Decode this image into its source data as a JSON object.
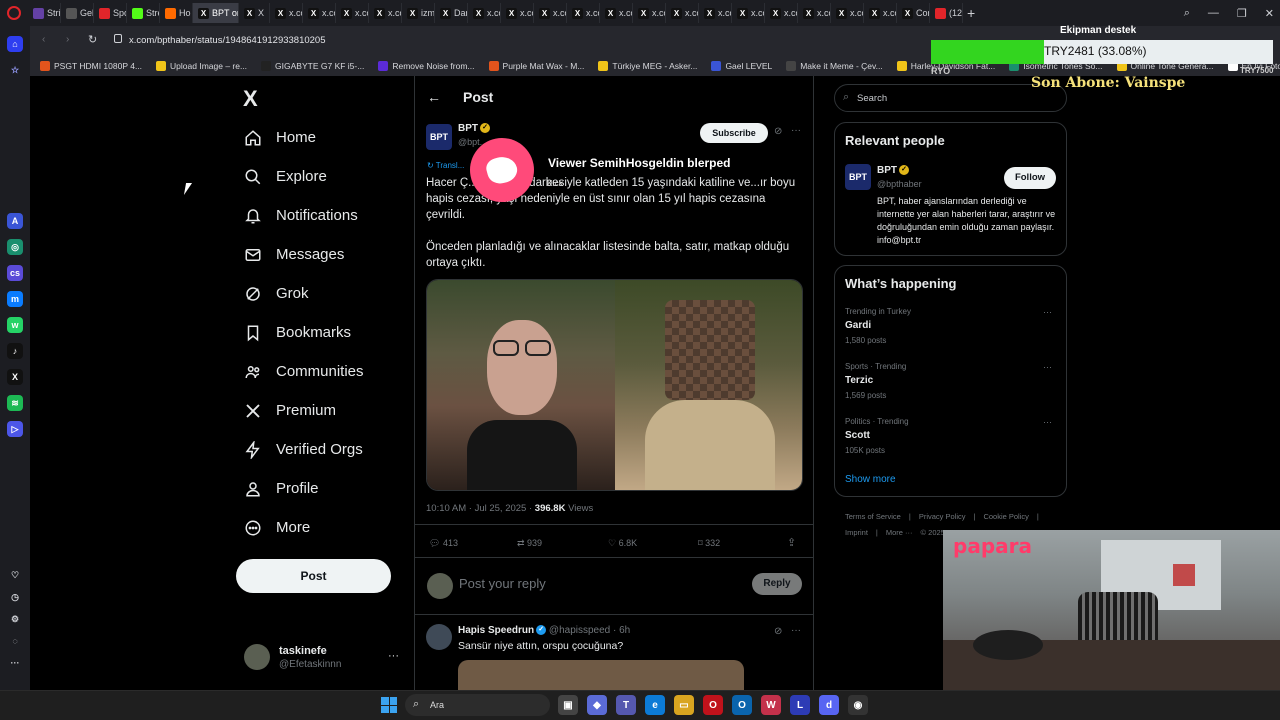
{
  "browser": {
    "tabs": [
      "Stri",
      "Gel",
      "Spo",
      "Stre",
      "Ho",
      "BPT on",
      "X",
      "x.co",
      "x.co",
      "x.co",
      "x.co",
      "izm",
      "Dar",
      "x.co",
      "x.co",
      "x.co",
      "x.co",
      "x.co",
      "x.co",
      "x.co",
      "x.co",
      "x.co",
      "x.co",
      "x.co",
      "x.co",
      "x.co",
      "Cor",
      "(12"
    ],
    "url": "x.com/bpthaber/status/1948641912933810205",
    "bookmarks": [
      "PSGT HDMI 1080P 4...",
      "Upload Image – re...",
      "GIGABYTE G7 KF i5-...",
      "Remove Noise from...",
      "Purple Mat Wax - M...",
      "Türkiye MEG - Asker...",
      "Gael LEVEL",
      "Make it Meme - Çev...",
      "Harley-Davidson Fat...",
      "Isometric Tones So...",
      "Online Tone Genera...",
      "En İyi Fotoğraf ve Vi..."
    ],
    "window_controls": [
      "—",
      "❐",
      "✕"
    ]
  },
  "nav": {
    "logo": "X",
    "items": [
      "Home",
      "Explore",
      "Notifications",
      "Messages",
      "Grok",
      "Bookmarks",
      "Communities",
      "Premium",
      "Verified Orgs",
      "Profile",
      "More"
    ],
    "post_button": "Post",
    "account_name": "taskinefe",
    "account_handle": "@Efetaskinnn"
  },
  "post": {
    "header": "Post",
    "author_name": "BPT",
    "author_handle": "@bpt...",
    "subscribe": "Subscribe",
    "translate_label": "Transl...",
    "text_1": "Hacer Ç...                    'i 1...ıçak darbesiyle katleden 15 yaşındaki katiline ve...ır boyu hapis cezası, yaşı nedeniyle en üst sınır olan 15 yıl hapis cezasına çevrildi.",
    "text_2": "Önceden planladığı ve alınacaklar listesinde balta, satır, matkap olduğu ortaya çıktı.",
    "timestamp": "10:10 AM · Jul 25, 2025 ·",
    "views": "396.8K",
    "views_label": "Views",
    "replies": "413",
    "reposts": "939",
    "likes": "6.8K",
    "bookmarks": "332",
    "reply_placeholder": "Post your reply",
    "reply_button": "Reply"
  },
  "reply": {
    "name": "Hapis Speedrun",
    "handle": "@hapisspeed · 6h",
    "text": "Sansür niye attın, orspu çocuğuna?"
  },
  "right": {
    "search_placeholder": "Search",
    "relevant_title": "Relevant people",
    "person_name": "BPT",
    "person_handle": "@bpthaber",
    "follow": "Follow",
    "person_bio": "BPT, haber ajanslarından derlediği ve internette yer alan haberleri tarar, araştırır ve doğruluğundan emin olduğu zaman paylaşır. info@bpt.tr",
    "happening_title": "What’s happening",
    "trends": [
      {
        "context": "Trending in Turkey",
        "name": "Gardi",
        "posts": "1,580 posts"
      },
      {
        "context": "Sports · Trending",
        "name": "Terzic",
        "posts": "1,569 posts"
      },
      {
        "context": "Politics · Trending",
        "name": "Scott",
        "posts": "105K posts"
      }
    ],
    "show_more": "Show more",
    "footer_1": [
      "Terms of Service",
      "Privacy Policy",
      "Cookie Policy"
    ],
    "footer_2": [
      "Imprint",
      "More ···",
      "© 2025 X..."
    ]
  },
  "overlay": {
    "donation_title": "Ekipman destek",
    "donation_value": "TRY2481 (33.08%)",
    "donation_progress": 0.3308,
    "donation_left": "RYO",
    "donation_right": "TRY7500",
    "last_sub": "Son Abone: Vainspe",
    "viewer_msg": "Viewer SemihHosgeldin blerped",
    "viewer_sub": "Kick",
    "papara": "papara"
  },
  "taskbar": {
    "search": "Ara"
  }
}
